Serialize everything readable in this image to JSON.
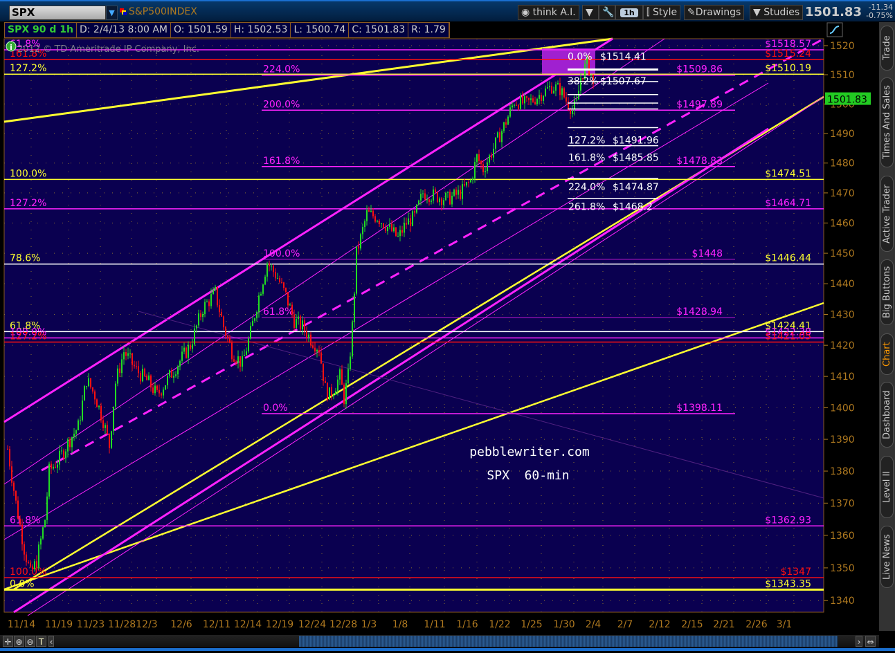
{
  "toolbar": {
    "symbol": "SPX",
    "symbol_name": "S&P500INDEX",
    "think_ai": "think A.I.",
    "timeframe": "1h",
    "style": "Style",
    "drawings": "Drawings",
    "studies": "Studies",
    "last": "1501.83",
    "change": "-11.34",
    "change_pct": "-0.75%"
  },
  "info": {
    "title": "SPX 90 d 1h",
    "date": "D: 2/4/13 8:00 AM",
    "open": "O: 1501.59",
    "high": "H: 1502.53",
    "low": "L: 1500.74",
    "close": "C: 1501.83",
    "range": "R: 1.79"
  },
  "copyright": "2012 © TD Ameritrade IP Company, Inc.",
  "watermark": {
    "site": "pebblewriter.com",
    "subtitle": "SPX  60-min"
  },
  "sidebar": {
    "tabs": [
      "Trade",
      "Times And Sales",
      "Active Trader",
      "Big Buttons",
      "Chart",
      "Dashboard",
      "Level II",
      "Live News"
    ],
    "active": "Chart"
  },
  "colors": {
    "bg": "#0a0050",
    "magenta": "#ff22ff",
    "red": "#ff1010",
    "yellow": "#ffff30",
    "white": "#ffffff",
    "up": "#22dd22",
    "down": "#ff1010",
    "axis": "#b07a20",
    "active_tab": "#ff9900"
  },
  "chart_data": {
    "type": "candlestick",
    "symbol": "SPX",
    "interval": "1h",
    "yaxis": {
      "scale": "log",
      "range": [
        1335,
        1523
      ],
      "ticks": [
        1340,
        1350,
        1360,
        1370,
        1380,
        1390,
        1400,
        1410,
        1420,
        1430,
        1440,
        1450,
        1460,
        1470,
        1480,
        1490,
        1500,
        1510,
        1520
      ]
    },
    "xaxis": {
      "ticks": [
        "11/14",
        "11/19",
        "11/23",
        "11/28",
        "12/3",
        "12/6",
        "12/11",
        "12/14",
        "12/19",
        "12/24",
        "12/28",
        "1/3",
        "1/8",
        "1/11",
        "1/16",
        "1/22",
        "1/25",
        "1/30",
        "2/4",
        "2/7",
        "2/12",
        "2/15",
        "2/21",
        "2/26",
        "3/1"
      ]
    },
    "current_price": "1501.83",
    "price_path": [
      [
        0,
        1387
      ],
      [
        4,
        1370
      ],
      [
        8,
        1356
      ],
      [
        11,
        1348
      ],
      [
        14,
        1352
      ],
      [
        18,
        1365
      ],
      [
        20,
        1380
      ],
      [
        25,
        1384
      ],
      [
        30,
        1390
      ],
      [
        34,
        1394
      ],
      [
        38,
        1409
      ],
      [
        42,
        1404
      ],
      [
        46,
        1396
      ],
      [
        49,
        1388
      ],
      [
        52,
        1408
      ],
      [
        56,
        1418
      ],
      [
        62,
        1412
      ],
      [
        68,
        1408
      ],
      [
        72,
        1404
      ],
      [
        76,
        1408
      ],
      [
        82,
        1414
      ],
      [
        88,
        1420
      ],
      [
        94,
        1432
      ],
      [
        100,
        1437
      ],
      [
        104,
        1426
      ],
      [
        108,
        1418
      ],
      [
        113,
        1414
      ],
      [
        117,
        1424
      ],
      [
        121,
        1436
      ],
      [
        125,
        1447
      ],
      [
        130,
        1442
      ],
      [
        134,
        1436
      ],
      [
        138,
        1428
      ],
      [
        142,
        1426
      ],
      [
        146,
        1422
      ],
      [
        150,
        1419
      ],
      [
        153,
        1406
      ],
      [
        155,
        1404
      ],
      [
        157,
        1406
      ],
      [
        160,
        1410
      ],
      [
        162,
        1403
      ],
      [
        164,
        1410
      ],
      [
        166,
        1426
      ],
      [
        168,
        1450
      ],
      [
        170,
        1455
      ],
      [
        173,
        1463
      ],
      [
        178,
        1462
      ],
      [
        184,
        1458
      ],
      [
        188,
        1455
      ],
      [
        192,
        1460
      ],
      [
        196,
        1462
      ],
      [
        200,
        1470
      ],
      [
        206,
        1469
      ],
      [
        212,
        1468
      ],
      [
        218,
        1470
      ],
      [
        223,
        1474
      ],
      [
        226,
        1482
      ],
      [
        229,
        1478
      ],
      [
        232,
        1482
      ],
      [
        236,
        1488
      ],
      [
        240,
        1494
      ],
      [
        244,
        1501
      ],
      [
        250,
        1500
      ],
      [
        256,
        1503
      ],
      [
        262,
        1506
      ],
      [
        266,
        1505
      ],
      [
        270,
        1500
      ],
      [
        272,
        1498
      ],
      [
        274,
        1500
      ],
      [
        276,
        1509
      ],
      [
        279,
        1514
      ],
      [
        281,
        1510
      ],
      [
        283,
        1502
      ]
    ],
    "levels": [
      {
        "price": 1518.57,
        "color": "magenta",
        "left": "61.8%",
        "right": "$1518.57",
        "span": "full"
      },
      {
        "price": 1515.24,
        "color": "red",
        "left": "161.8%",
        "right": "$1515.24",
        "span": "full"
      },
      {
        "price": 1510.19,
        "color": "yellow",
        "left": "127.2%",
        "right": "$1510.19",
        "span": "full"
      },
      {
        "price": 1509.86,
        "color": "magenta",
        "left": "224.0%",
        "right": "$1509.86",
        "span": "mid"
      },
      {
        "price": 1497.89,
        "color": "magenta",
        "left": "200.0%",
        "right": "$1497.89",
        "span": "mid"
      },
      {
        "price": 1478.83,
        "color": "magenta",
        "left": "161.8%",
        "right": "$1478.83",
        "span": "mid"
      },
      {
        "price": 1474.51,
        "color": "yellow",
        "left": "100.0%",
        "right": "$1474.51",
        "span": "full"
      },
      {
        "price": 1464.71,
        "color": "magenta",
        "left": "127.2%",
        "right": "$1464.71",
        "span": "full"
      },
      {
        "price": 1448,
        "color": "magenta",
        "left": "100.0%",
        "right": "$1448",
        "span": "mid"
      },
      {
        "price": 1446.44,
        "color": "yellow",
        "left": "78.6%",
        "right": "$1446.44",
        "span": "full"
      },
      {
        "price": 1428.94,
        "color": "magenta",
        "left": "61.8%",
        "right": "$1428.94",
        "span": "mid"
      },
      {
        "price": 1424.41,
        "color": "yellow",
        "left": "61.8%",
        "right": "$1424.41",
        "span": "full"
      },
      {
        "price": 1422.38,
        "color": "magenta",
        "left": "100.0%",
        "right": "$1422.38",
        "span": "full"
      },
      {
        "price": 1421.05,
        "color": "red",
        "left": "127.2%",
        "right": "$1421.05",
        "span": "full"
      },
      {
        "price": 1398.11,
        "color": "magenta",
        "left": "0.0%",
        "right": "$1398.11",
        "span": "mid"
      },
      {
        "price": 1362.93,
        "color": "magenta",
        "left": "61.8%",
        "right": "$1362.93",
        "span": "full"
      },
      {
        "price": 1347,
        "color": "red",
        "left": "100.0%",
        "right": "$1347",
        "span": "full"
      },
      {
        "price": 1343.35,
        "color": "yellow",
        "left": "0.0%",
        "right": "$1343.35",
        "span": "full"
      }
    ],
    "fib_extension": [
      {
        "pct": "0.0%",
        "price": "$1514.41",
        "value": 1514.41
      },
      {
        "pct": "38.2%",
        "price": "$1507.67",
        "value": 1507.67
      },
      {
        "pct": "127.2%",
        "price": "$1491.96",
        "value": 1491.96
      },
      {
        "pct": "161.8%",
        "price": "$1485.85",
        "value": 1485.85
      },
      {
        "pct": "224.0%",
        "price": "$1474.87",
        "value": 1474.87
      },
      {
        "pct": "261.8%",
        "price": "$1468.2",
        "value": 1468.2
      }
    ]
  }
}
